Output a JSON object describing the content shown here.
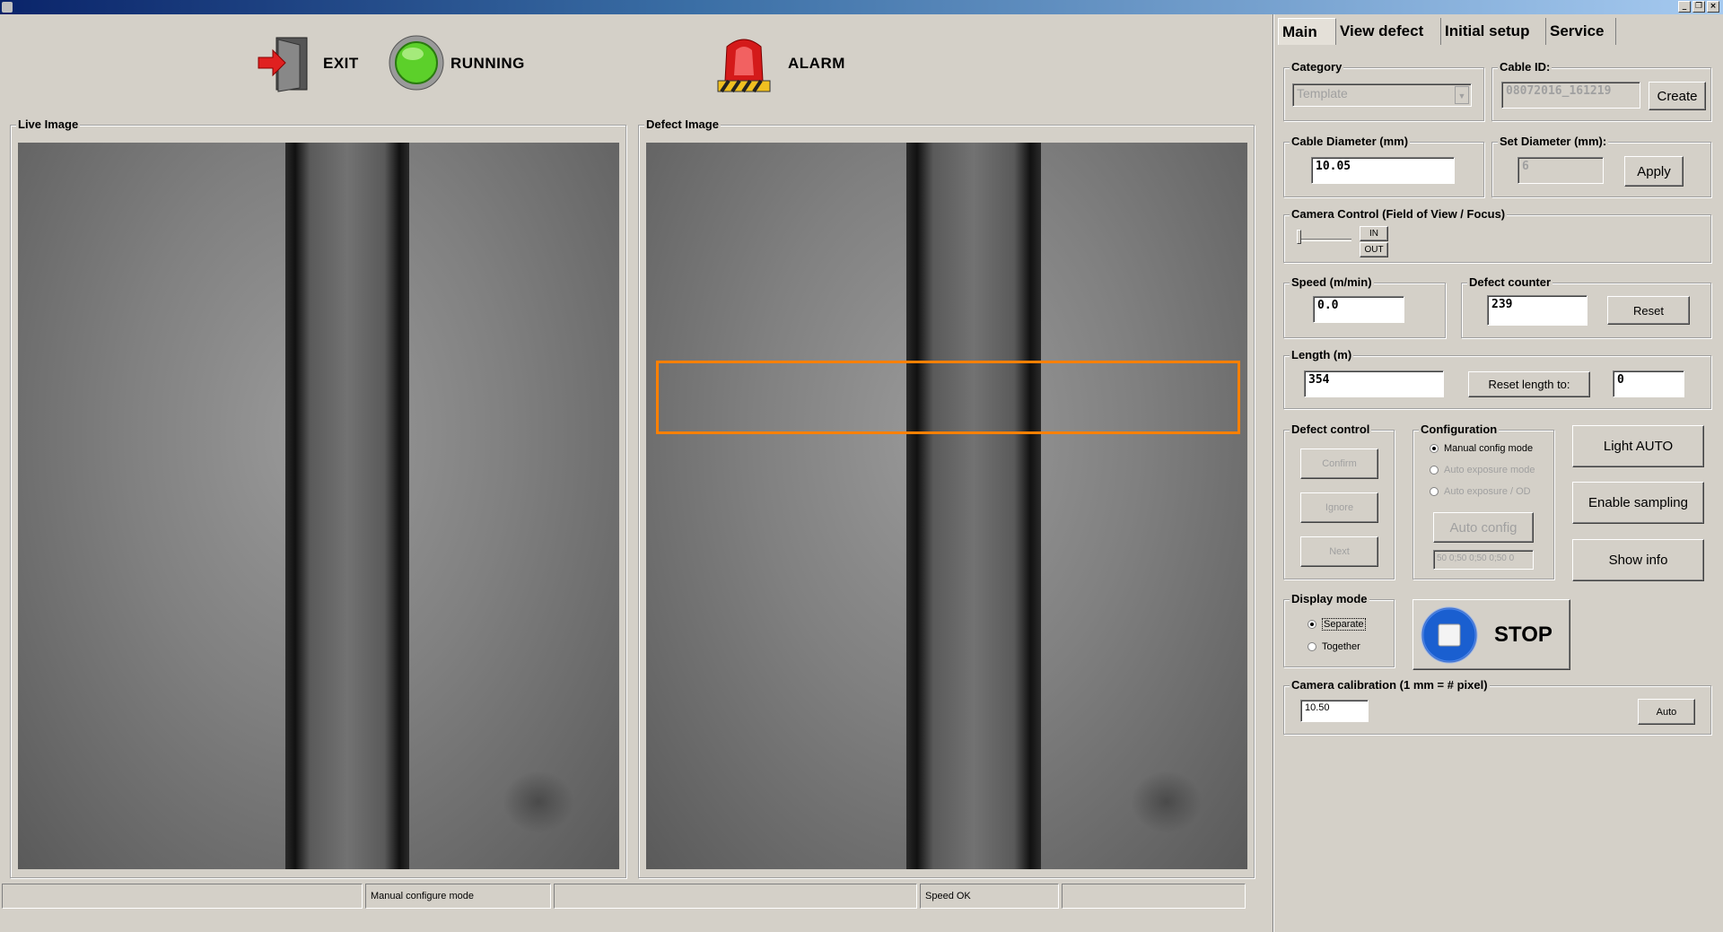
{
  "toolbar": {
    "exit_label": "EXIT",
    "running_label": "RUNNING",
    "alarm_label": "ALARM"
  },
  "panels": {
    "live_title": "Live Image",
    "defect_title": "Defect Image"
  },
  "tabs": [
    "Main",
    "View defect",
    "Initial setup",
    "Service"
  ],
  "category": {
    "title": "Category",
    "value": "Template"
  },
  "cable_id": {
    "title": "Cable ID:",
    "value": "08072016_161219",
    "create_label": "Create"
  },
  "cable_diameter": {
    "title": "Cable Diameter (mm)",
    "value": "10.05"
  },
  "set_diameter": {
    "title": "Set Diameter (mm):",
    "value": "6",
    "apply_label": "Apply"
  },
  "camera_control": {
    "title": "Camera Control (Field of View / Focus)",
    "in_label": "IN",
    "out_label": "OUT"
  },
  "speed": {
    "title": "Speed (m/min)",
    "value": "0.0"
  },
  "defect_counter": {
    "title": "Defect counter",
    "value": "239",
    "reset_label": "Reset"
  },
  "length": {
    "title": "Length (m)",
    "value": "354",
    "reset_to_label": "Reset length to:",
    "reset_to_value": "0"
  },
  "defect_control": {
    "title": "Defect control",
    "confirm_label": "Confirm",
    "ignore_label": "Ignore",
    "next_label": "Next"
  },
  "configuration": {
    "title": "Configuration",
    "options": [
      "Manual config mode",
      "Auto exposure mode",
      "Auto exposure / OD"
    ],
    "auto_config_label": "Auto config",
    "values": "50 0;50 0;50 0;50 0"
  },
  "side_buttons": {
    "light_auto": "Light AUTO",
    "enable_sampling": "Enable sampling",
    "show_info": "Show info"
  },
  "display_mode": {
    "title": "Display mode",
    "separate": "Separate",
    "together": "Together"
  },
  "stop_label": "STOP",
  "calibration": {
    "title": "Camera calibration (1 mm = # pixel)",
    "value": "10.50",
    "auto_label": "Auto"
  },
  "statusbar": [
    "",
    "Manual configure mode",
    "",
    "Speed OK",
    ""
  ],
  "colors": {
    "defect_box": "#ff8000",
    "stop_blue": "#1a5fd0",
    "running_green": "#5cd02a",
    "alarm_red": "#d41a1a"
  }
}
